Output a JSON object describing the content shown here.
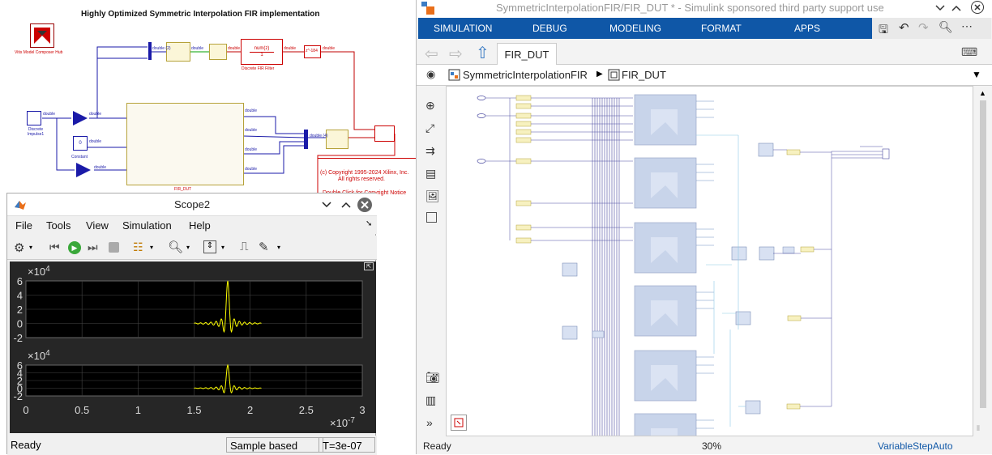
{
  "model": {
    "title": "Highly Optimized Symmetric Interpolation FIR implementation",
    "hub_label": "Vitis Model Composer Hub",
    "impulse_label": "Discrete Impulse1",
    "constant_label": "Constant",
    "fir_dut_label": "FIR_DUT",
    "discrete_filter_label": "Discrete FIR Filter",
    "transfer_num": "num(z)",
    "transfer_den": "1",
    "delay_label": "z^-184",
    "signal_type": "double",
    "copyright_line1": "(c) Copyright 1995-2024 Xilinx, Inc.",
    "copyright_line2": "All rights reserved.",
    "copyright_line3": "Double Click for Copyright Notice",
    "mux_label_2": "double (2)",
    "mux_label_4": "double (4)"
  },
  "scope": {
    "title": "Scope2",
    "menu": [
      "File",
      "Tools",
      "View",
      "Simulation",
      "Help"
    ],
    "y_exponent_top": "×10^4",
    "y_exponent_bottom": "×10^4",
    "y_ticks_top": [
      "6",
      "4",
      "2",
      "0",
      "-2"
    ],
    "y_ticks_bottom": [
      "6",
      "4",
      "2",
      "0",
      "-2"
    ],
    "x_ticks": [
      "0",
      "0.5",
      "1",
      "1.5",
      "2",
      "2.5",
      "3"
    ],
    "x_exponent": "×10^-7",
    "status": "Ready",
    "sample_mode": "Sample based",
    "time": "T=3e-07",
    "trace_color": "#ffff00"
  },
  "simulink": {
    "title": "SymmetricInterpolationFIR/FIR_DUT * - Simulink sponsored third party support use",
    "ribbon_tabs": [
      "SIMULATION",
      "DEBUG",
      "MODELING",
      "FORMAT",
      "APPS"
    ],
    "tab": "FIR_DUT",
    "breadcrumb": [
      "SymmetricInterpolationFIR",
      "FIR_DUT"
    ],
    "status": "Ready",
    "zoom": "30%",
    "solver": "VariableStepAuto",
    "accent": "#0f57a7"
  }
}
